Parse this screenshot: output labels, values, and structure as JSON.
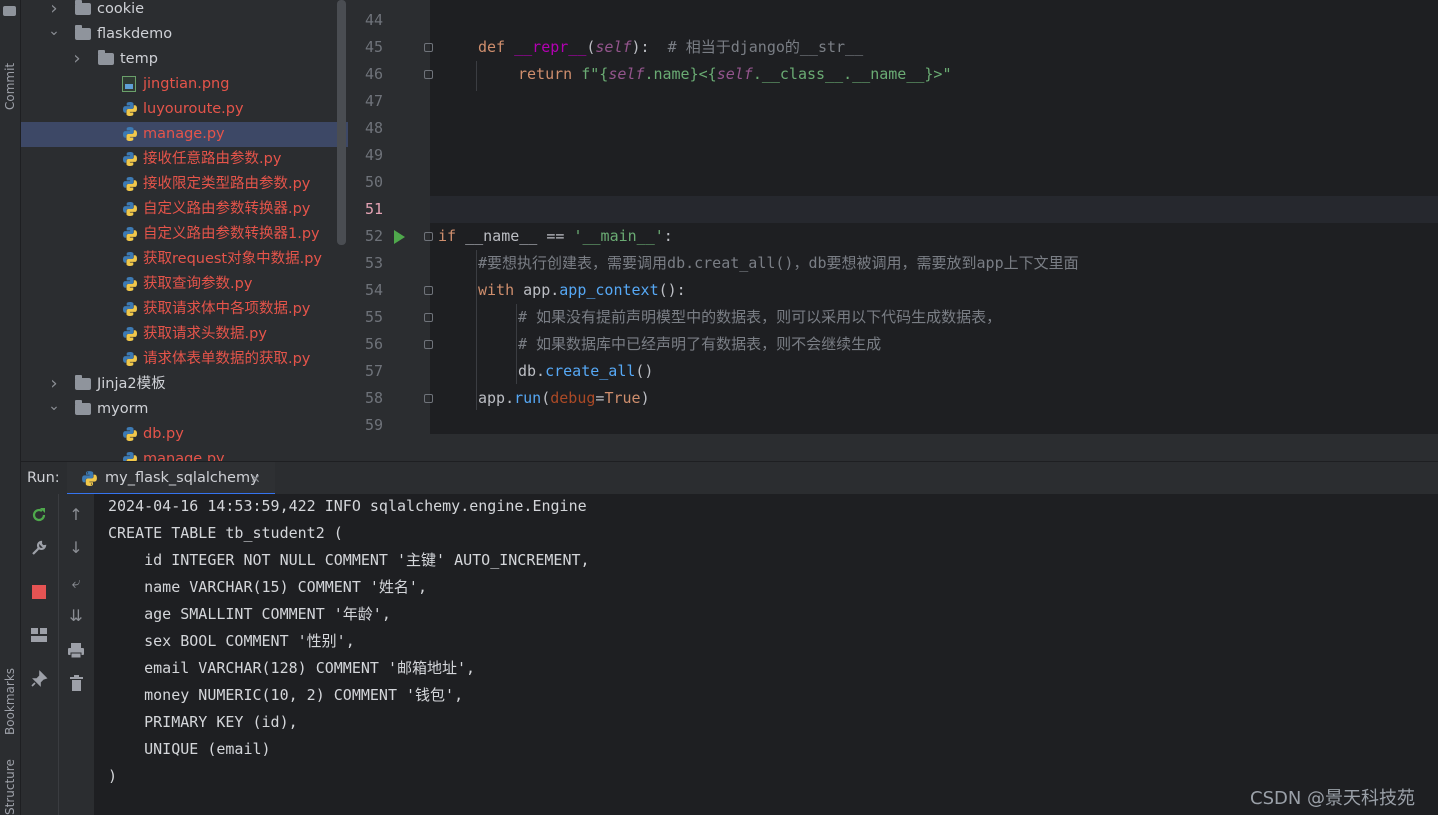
{
  "side_labels": {
    "commit": "Commit",
    "bookmarks": "Bookmarks",
    "structure": "Structure"
  },
  "tree": [
    {
      "name": "cookie",
      "type": "folder",
      "expanded": false
    },
    {
      "name": "flaskdemo",
      "type": "folder",
      "expanded": true
    },
    {
      "name": "temp",
      "type": "folder",
      "expanded": false
    },
    {
      "name": "jingtian.png",
      "type": "png"
    },
    {
      "name": "luyouroute.py",
      "type": "py"
    },
    {
      "name": "manage.py",
      "type": "py",
      "selected": true
    },
    {
      "name": "接收任意路由参数.py",
      "type": "py"
    },
    {
      "name": "接收限定类型路由参数.py",
      "type": "py"
    },
    {
      "name": "自定义路由参数转换器.py",
      "type": "py"
    },
    {
      "name": "自定义路由参数转换器1.py",
      "type": "py"
    },
    {
      "name": "获取request对象中数据.py",
      "type": "py"
    },
    {
      "name": "获取查询参数.py",
      "type": "py"
    },
    {
      "name": "获取请求体中各项数据.py",
      "type": "py"
    },
    {
      "name": "获取请求头数据.py",
      "type": "py"
    },
    {
      "name": "请求体表单数据的获取.py",
      "type": "py"
    },
    {
      "name": "Jinja2模板",
      "type": "folder",
      "expanded": false
    },
    {
      "name": "myorm",
      "type": "folder",
      "expanded": true
    },
    {
      "name": "db.py",
      "type": "py"
    },
    {
      "name": "manage.py",
      "type": "py"
    }
  ],
  "editor": {
    "current_line": "51",
    "line_numbers": [
      "44",
      "45",
      "46",
      "47",
      "48",
      "49",
      "50",
      "51",
      "52",
      "53",
      "54",
      "55",
      "56",
      "57",
      "58",
      "59"
    ],
    "code": {
      "l45_def": "def ",
      "l45_name": "__repr__",
      "l45_open": "(",
      "l45_self": "self",
      "l45_close": "):  ",
      "l45_comment": "# 相当于django的__str__",
      "l46_return": "return ",
      "l46_str1": "f\"{",
      "l46_self": "self",
      "l46_name": ".name}<{",
      "l46_self2": "self",
      "l46_class": ".__class__.__name__}>\"",
      "l52_if": "if ",
      "l52_mid": "__name__ == ",
      "l52_str": "'__main__'",
      "l52_colon": ":",
      "l53_comment": "#要想执行创建表，需要调用db.creat_all()，db要想被调用，需要放到app上下文里面",
      "l54_with": "with ",
      "l54_app": "app.",
      "l54_fn": "app_context",
      "l54_end": "():",
      "l55_comment": "# 如果没有提前声明模型中的数据表，则可以采用以下代码生成数据表，",
      "l56_comment": "# 如果数据库中已经声明了有数据表，则不会继续生成",
      "l57_db": "db.",
      "l57_fn": "create_all",
      "l57_end": "()",
      "l58_app": "app.",
      "l58_fn": "run",
      "l58_open": "(",
      "l58_param": "debug",
      "l58_eq": "=",
      "l58_true": "True",
      "l58_close": ")"
    }
  },
  "run": {
    "label": "Run:",
    "tab_label": "my_flask_sqlalchemy",
    "tab_close": "✕",
    "console_lines": [
      "2024-04-16 14:53:59,422 INFO sqlalchemy.engine.Engine",
      "CREATE TABLE tb_student2 (",
      "    id INTEGER NOT NULL COMMENT '主键' AUTO_INCREMENT,",
      "    name VARCHAR(15) COMMENT '姓名',",
      "    age SMALLINT COMMENT '年龄',",
      "    sex BOOL COMMENT '性别',",
      "    email VARCHAR(128) COMMENT '邮箱地址',",
      "    money NUMERIC(10, 2) COMMENT '钱包',",
      "    PRIMARY KEY (id),",
      "    UNIQUE (email)",
      ")"
    ]
  },
  "toolbar_icons": [
    "rerun-icon",
    "wrench-icon",
    "stop-icon",
    "layout-icon",
    "pin-icon",
    "up-arrow-icon",
    "down-arrow-icon",
    "soft-wrap-icon",
    "scroll-to-end-icon",
    "print-icon",
    "trash-icon"
  ],
  "watermark": "CSDN @景天科技苑",
  "colors": {
    "accent": "#3574f0",
    "modified_file": "#e5544a",
    "run_green": "#4fa84c",
    "stop_red": "#e55353"
  }
}
